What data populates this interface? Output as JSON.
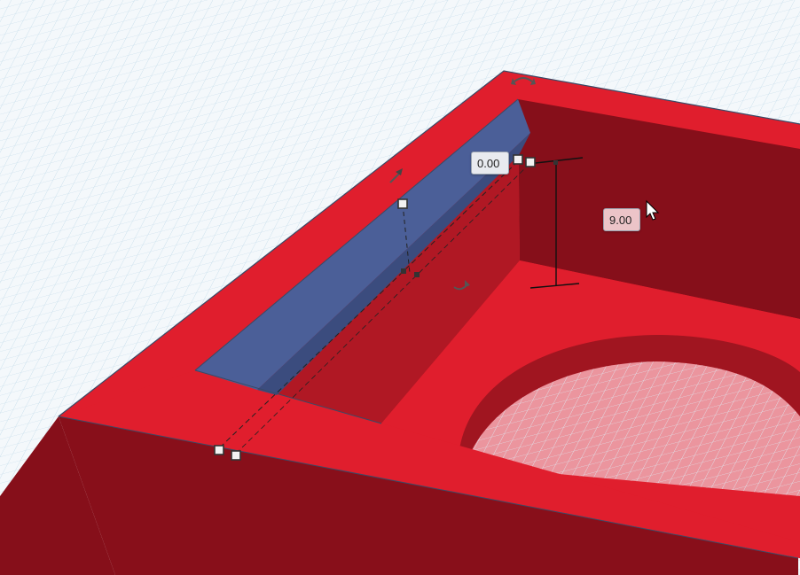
{
  "workplane": {
    "grid": true,
    "background_color": "#f4f8fb",
    "grid_color": "#bcd6e6"
  },
  "model": {
    "box_color": "#e01e2d",
    "box_shade_color": "#860f1a",
    "wedge_color": "#4a5f97"
  },
  "dimensions": {
    "width_value": "0.00",
    "height_value": "9.00"
  },
  "icons": [
    "rotate-arc-icon",
    "lift-arrow-icon",
    "resize-handle-icon",
    "mouse-cursor-icon"
  ]
}
